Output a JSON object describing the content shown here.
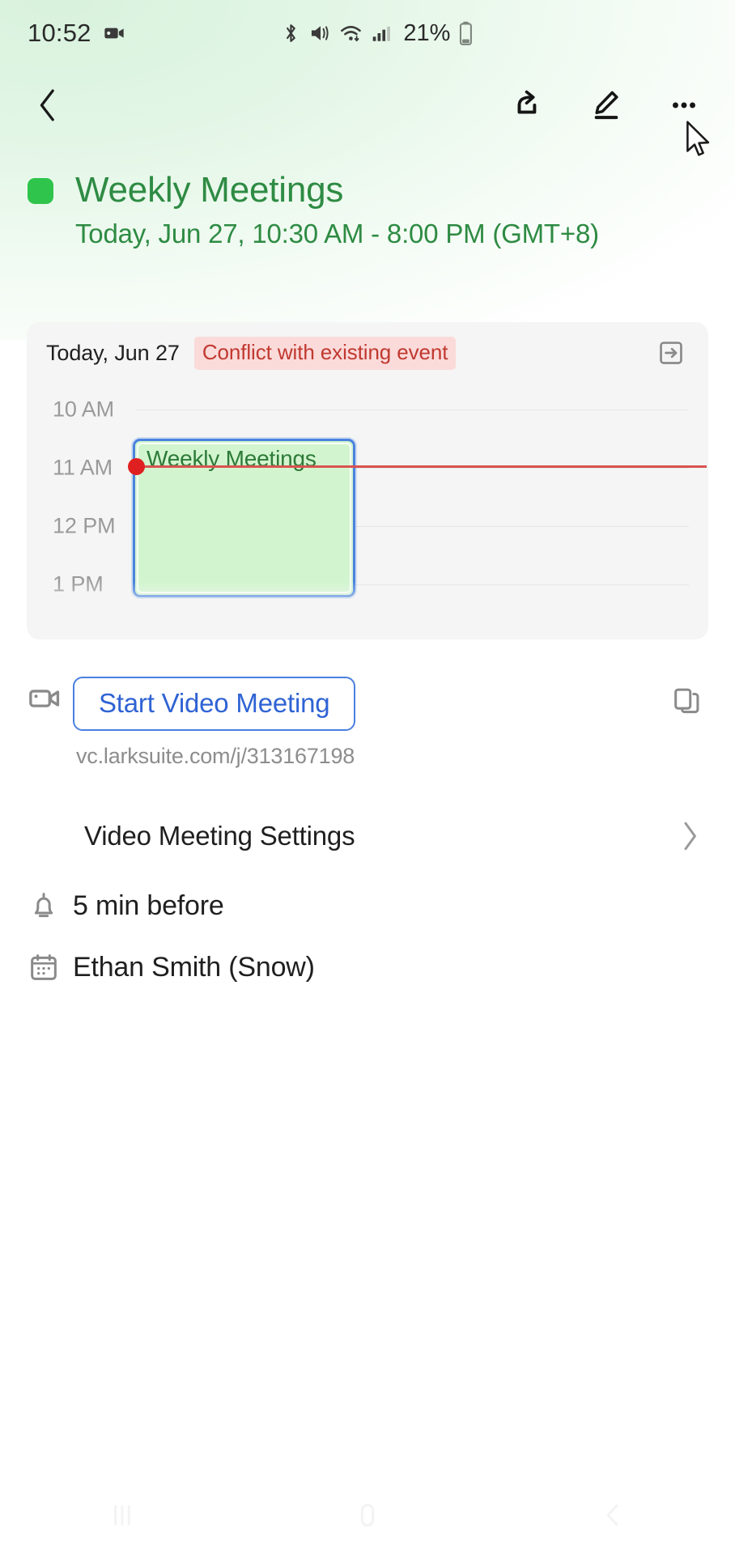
{
  "status_bar": {
    "clock": "10:52",
    "battery_percent": "21%",
    "icons": [
      "screen-record-icon",
      "bluetooth-icon",
      "vibrate-icon",
      "wifi-icon",
      "signal-icon",
      "battery-icon"
    ]
  },
  "toolbar": {
    "back_label": "",
    "share_label": "",
    "edit_label": "",
    "more_label": ""
  },
  "event": {
    "calendar_color": "#2fc44b",
    "title": "Weekly Meetings",
    "time": "Today, Jun 27, 10:30 AM - 8:00 PM (GMT+8)"
  },
  "preview": {
    "date": "Today, Jun 27",
    "conflict_label": "Conflict with existing event",
    "conflict_bg": "#fbdada",
    "conflict_color": "#c0392f",
    "expand_label": "",
    "hours": [
      "10 AM",
      "11 AM",
      "12 PM",
      "1 PM"
    ],
    "block_label": "Weekly Meetings",
    "block_fill": "#d2f5cf",
    "block_border": "#4a82e0",
    "now_line_color": "#d9534f"
  },
  "video_meeting": {
    "start_button": "Start Video Meeting",
    "url": "vc.larksuite.com/j/313167198",
    "copy_label": "",
    "settings_label": "Video Meeting Settings"
  },
  "details": {
    "reminder": "5 min before",
    "calendar_owner": "Ethan Smith (Snow)"
  },
  "navbar": {
    "recents_label": "",
    "home_label": "",
    "back_label": ""
  }
}
